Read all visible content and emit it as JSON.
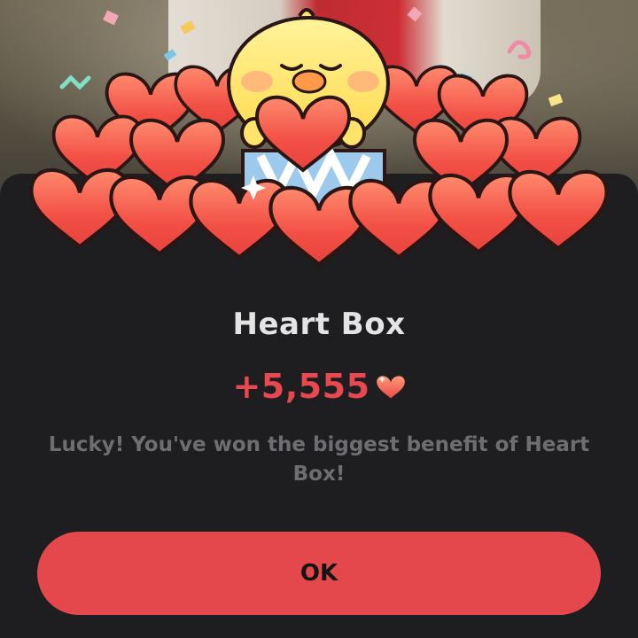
{
  "dialog": {
    "title": "Heart Box",
    "reward_amount": "+5,555",
    "message": "Lucky! You've won the biggest benefit of Heart Box!",
    "ok_label": "OK"
  },
  "icons": {
    "reward": "heart-icon",
    "mascot": "chick-mascot-illustration"
  },
  "colors": {
    "accent": "#e5484c",
    "reward_text": "#e9484f",
    "sheet_background": "#1e1e20",
    "title_text": "#e4e4e4",
    "message_text": "#6e6e72"
  }
}
